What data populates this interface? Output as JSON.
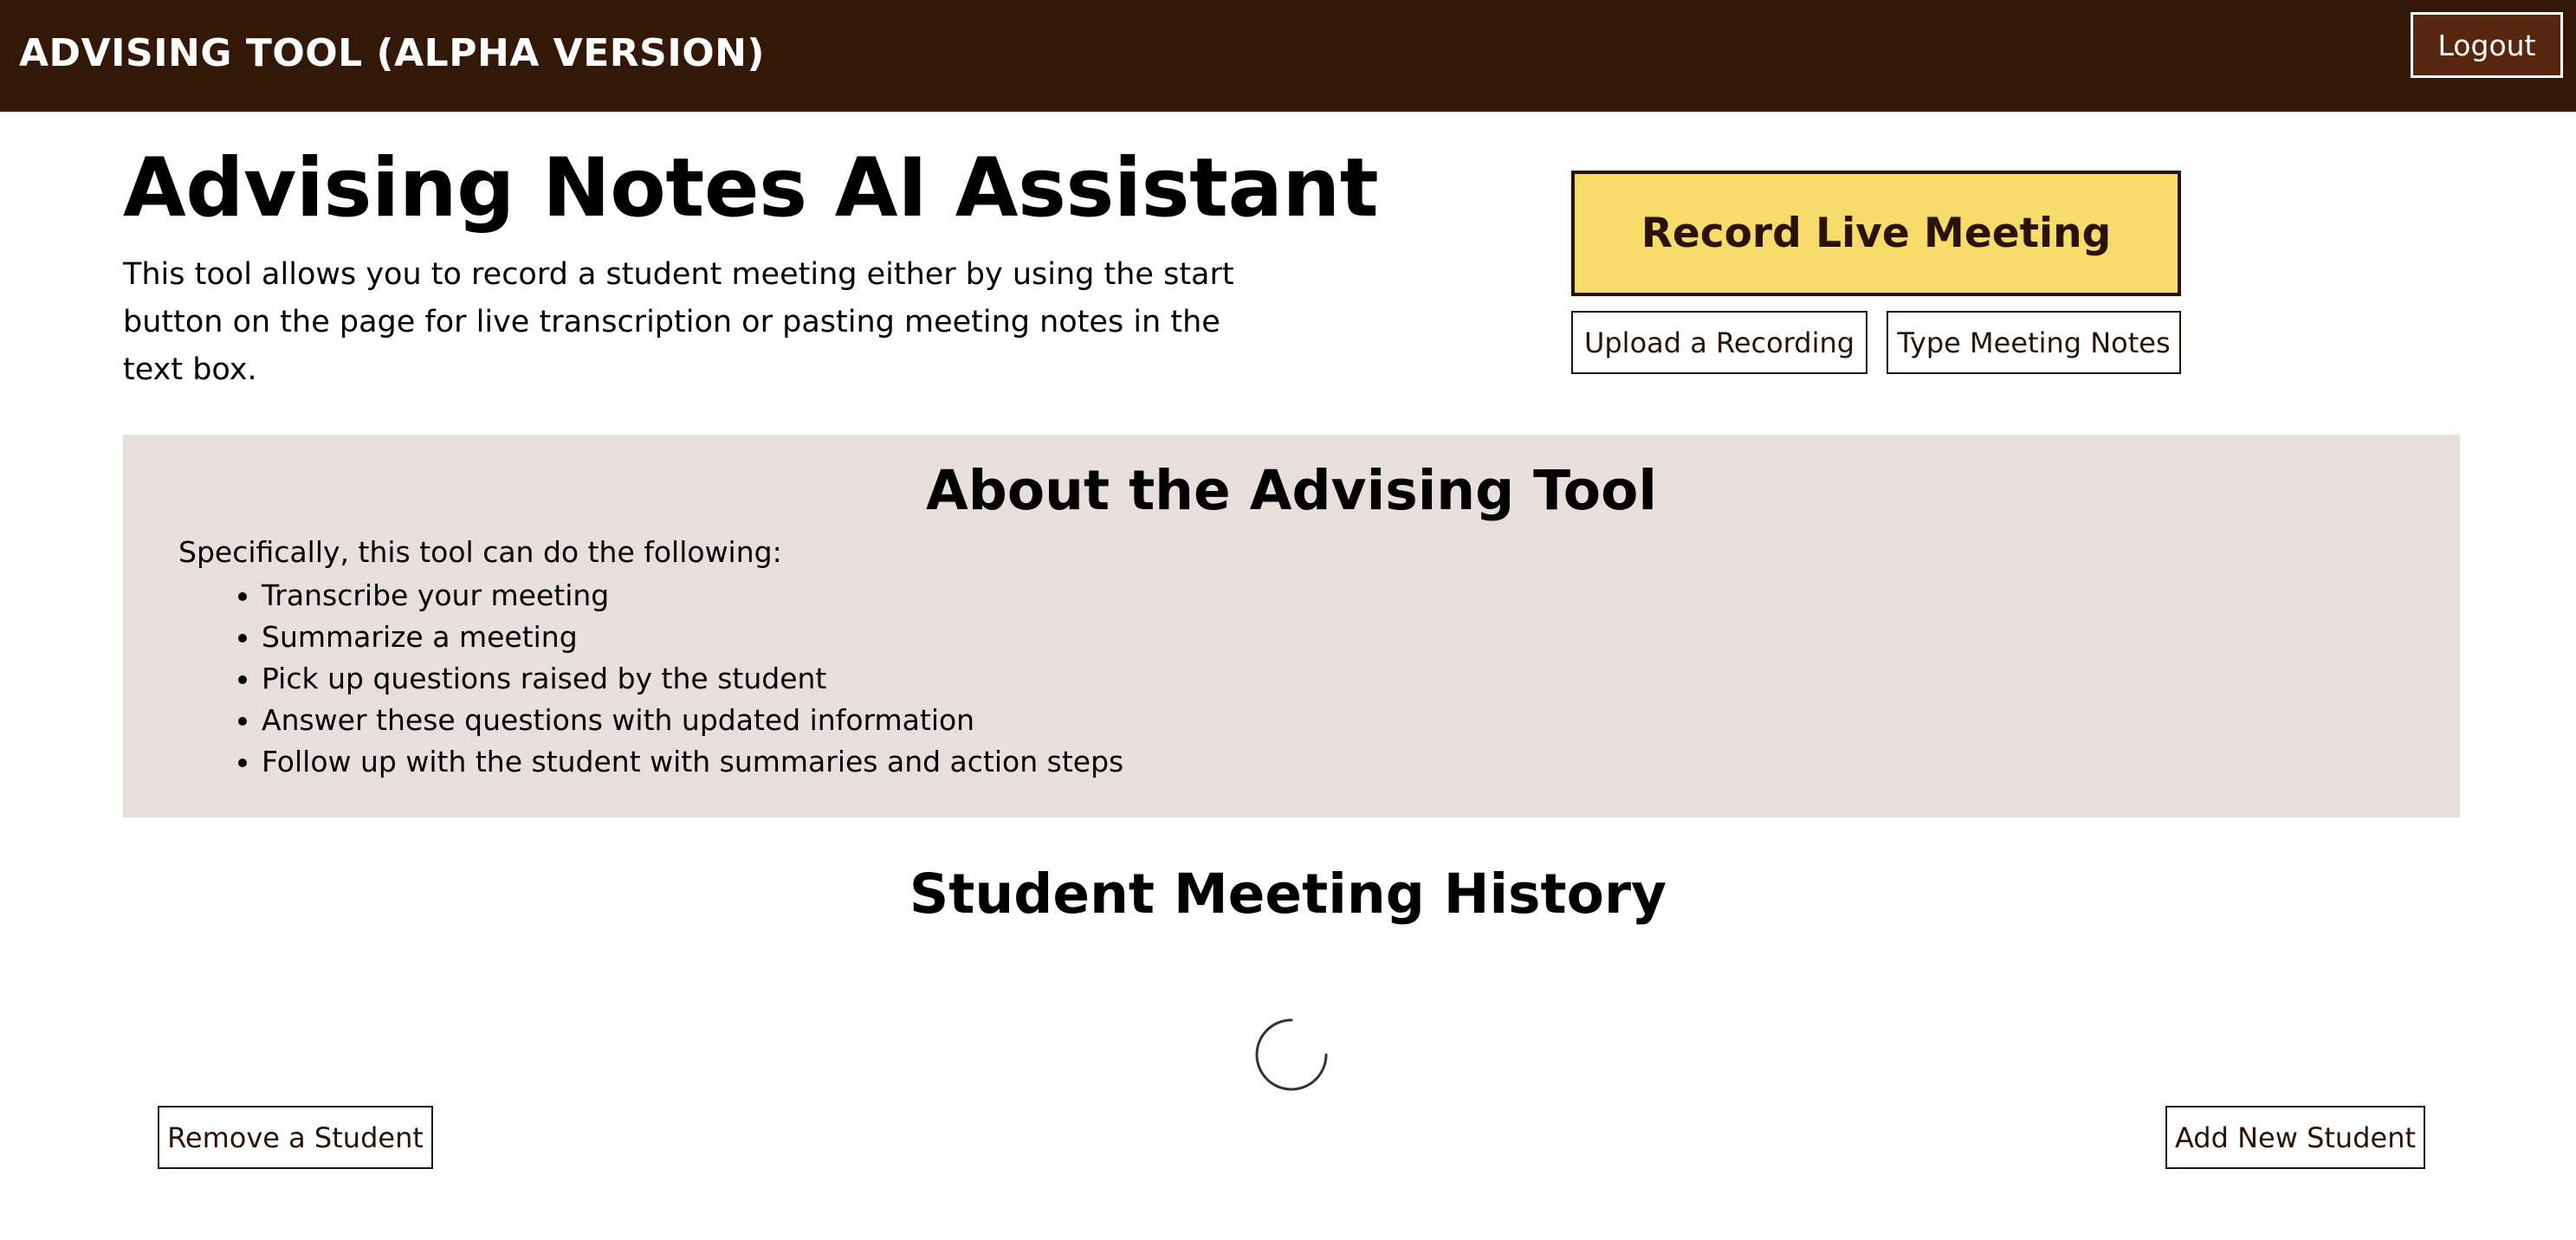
{
  "header": {
    "app_title": "ADVISING TOOL (ALPHA VERSION)",
    "logout_label": "Logout"
  },
  "hero": {
    "title": "Advising Notes AI Assistant",
    "description": "This tool allows you to record a student meeting either by using the start button on the page for live transcription or pasting meeting notes in the text box."
  },
  "actions": {
    "record_label": "Record Live Meeting",
    "upload_label": "Upload a Recording",
    "type_label": "Type Meeting Notes"
  },
  "about": {
    "title": "About the Advising Tool",
    "intro": "Specifically, this tool can do the following:",
    "items": [
      "Transcribe your meeting",
      "Summarize a meeting",
      "Pick up questions raised by the student",
      "Answer these questions with updated information",
      "Follow up with the student with summaries and action steps"
    ]
  },
  "history": {
    "title": "Student Meeting History",
    "remove_label": "Remove a Student",
    "add_label": "Add New Student",
    "loading_icon": "loading-spinner-icon"
  },
  "colors": {
    "header_bg": "#331707",
    "logout_bg": "#57260f",
    "record_bg": "#f8dc6a",
    "accent_dark": "#2a1206",
    "panel_bg": "#e7dfdc"
  }
}
